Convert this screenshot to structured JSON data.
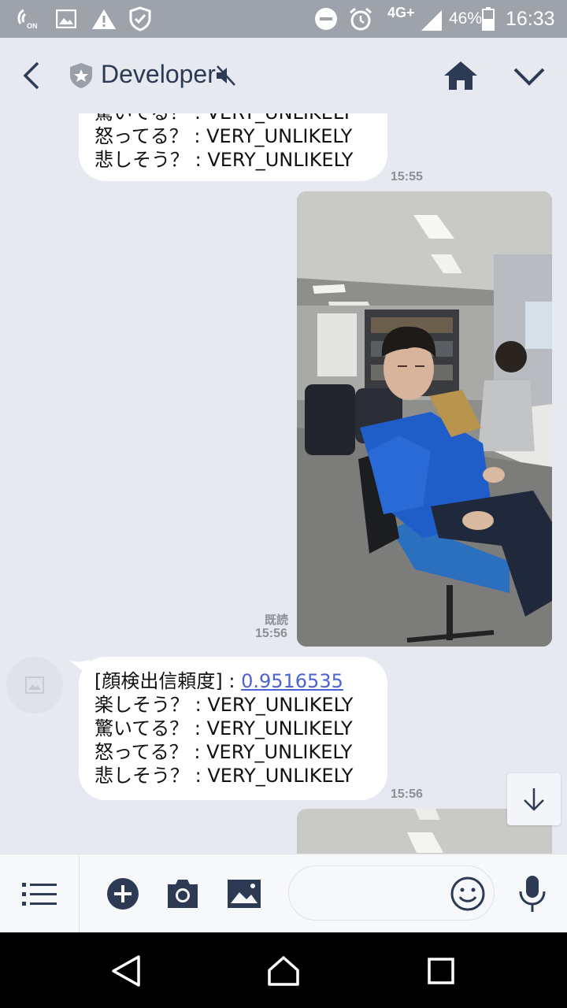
{
  "status_bar": {
    "network": "4G+",
    "battery": "46%",
    "time": "16:33",
    "icons": [
      "nfc-on-icon",
      "image-icon",
      "warning-icon",
      "shield-check-icon",
      "do-not-disturb-icon",
      "alarm-icon",
      "signal-icon",
      "battery-icon"
    ]
  },
  "header": {
    "title": "Developer",
    "icons": [
      "back-arrow-icon",
      "shield-star-icon",
      "mute-icon",
      "home-icon",
      "chevron-down-icon"
    ]
  },
  "messages": [
    {
      "type": "text",
      "side": "left",
      "lines": [
        "驚いてる？ : VERY_UNLIKELY",
        "怒ってる？ : VERY_UNLIKELY",
        "悲しそう？ : VERY_UNLIKELY"
      ],
      "time": "15:55"
    },
    {
      "type": "image",
      "side": "right",
      "read": "既読",
      "time": "15:56"
    },
    {
      "type": "text",
      "side": "left",
      "label": "[顔検出信頼度] : ",
      "link": "0.9516535",
      "lines": [
        "楽しそう？ : VERY_UNLIKELY",
        "驚いてる？ : VERY_UNLIKELY",
        "怒ってる？ : VERY_UNLIKELY",
        "悲しそう？ : VERY_UNLIKELY"
      ],
      "time": "15:56"
    }
  ],
  "toolbar": {
    "input_value": "",
    "icons": [
      "menu-list-icon",
      "add-icon",
      "camera-icon",
      "gallery-icon",
      "emoji-icon",
      "microphone-icon"
    ]
  },
  "navbar": {
    "icons": [
      "back-triangle-icon",
      "home-nav-icon",
      "recents-icon"
    ]
  },
  "colors": {
    "status_bar": "#9ea3ab",
    "chat_bg": "#e6e9f0",
    "header_text": "#2c3a54",
    "link": "#4e62d3",
    "time_text": "#8b8f96"
  }
}
